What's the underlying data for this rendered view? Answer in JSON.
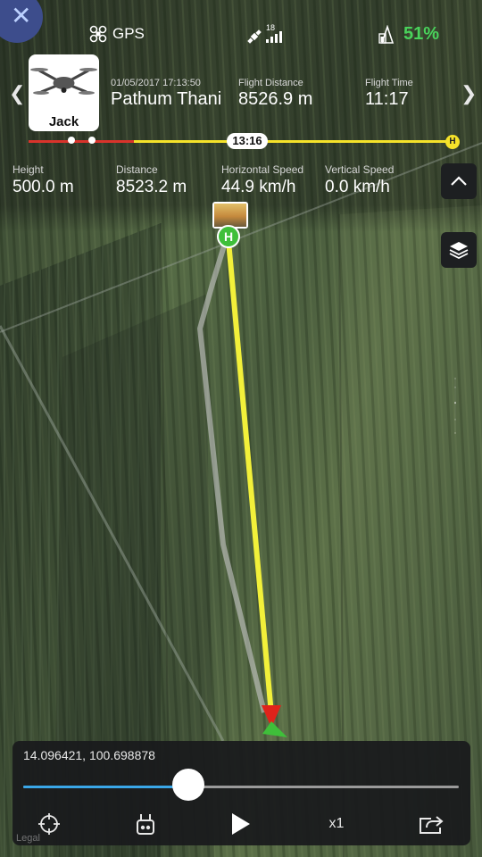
{
  "app": {
    "gps_label": "GPS",
    "satellite_count": "18",
    "battery_percent": "51%",
    "colors": {
      "battery": "#49d35b",
      "flight_path": "#f2f03a",
      "home": "#3fbf3a",
      "timeline_red": "#d9332b",
      "timeline_yellow": "#f5e22a",
      "slider_fill": "#3aa7e8"
    }
  },
  "aircraft": {
    "name": "Jack"
  },
  "flight": {
    "datetime": "01/05/2017 17:13:50",
    "location": "Pathum Thani",
    "distance_label": "Flight Distance",
    "distance_value": "8526.9 m",
    "time_label": "Flight Time",
    "time_value": "11:17"
  },
  "timeline": {
    "current_time": "13:16",
    "home_marker": "H",
    "progress": 0.46
  },
  "stats": [
    {
      "label": "Height",
      "value": "500.0 m"
    },
    {
      "label": "Distance",
      "value": "8523.2 m"
    },
    {
      "label": "Horizontal Speed",
      "value": "44.9 km/h"
    },
    {
      "label": "Vertical Speed",
      "value": "0.0 km/h"
    }
  ],
  "map": {
    "home_marker": "H",
    "watermark": "Legal"
  },
  "playback": {
    "coordinates": "14.096421, 100.698878",
    "progress": 0.38,
    "speed": "x1"
  },
  "icons": {
    "close": "close-icon",
    "gps": "drone-icon",
    "satellite": "satellite-icon",
    "battery": "battery-icon",
    "prev": "chevron-left-icon",
    "next": "chevron-right-icon",
    "collapse": "chevron-up-icon",
    "layers": "layers-icon",
    "locate": "crosshair-icon",
    "remote": "remote-controller-icon",
    "play": "play-icon",
    "share": "share-icon"
  }
}
